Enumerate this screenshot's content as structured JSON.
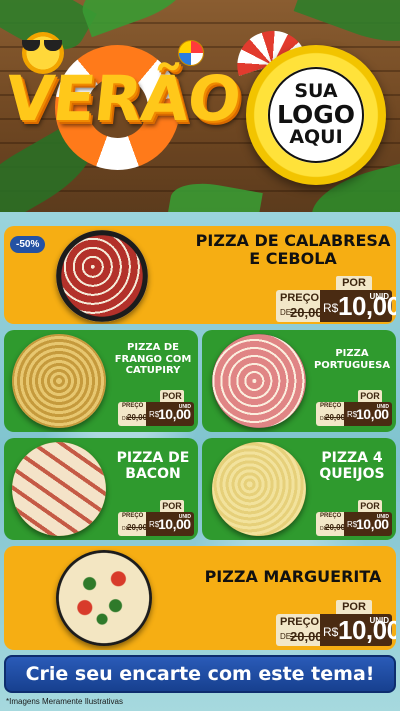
{
  "header": {
    "title": "VERÃO",
    "logo_lines": [
      "SUA",
      "LOGO",
      "AQUI"
    ]
  },
  "featured": [
    {
      "name_line1": "PIZZA DE CALABRESA",
      "name_line2": "E CEBOLA",
      "badge": "-50%",
      "por": "POR",
      "preco": "PREÇO",
      "de": "DE",
      "old_price": "20,00",
      "currency": "R$",
      "price": "10,00",
      "unit": "UNID"
    },
    {
      "name_line1": "PIZZA MARGUERITA",
      "por": "POR",
      "preco": "PREÇO",
      "de": "DE",
      "old_price": "20,00",
      "currency": "R$",
      "price": "10,00",
      "unit": "UNID"
    }
  ],
  "grid": [
    {
      "name_lines": [
        "PIZZA DE",
        "FRANGO COM",
        "CATUPIRY"
      ],
      "preco": "PREÇO",
      "por": "POR",
      "de": "DE",
      "old_price": "20,00",
      "currency": "R$",
      "price": "10,00",
      "unit": "UNID"
    },
    {
      "name_lines": [
        "PIZZA",
        "PORTUGUESA"
      ],
      "preco": "PREÇO",
      "por": "POR",
      "de": "DE",
      "old_price": "20,00",
      "currency": "R$",
      "price": "10,00",
      "unit": "UNID"
    },
    {
      "name_lines": [
        "PIZZA DE",
        "BACON"
      ],
      "preco": "PREÇO",
      "por": "POR",
      "de": "DE",
      "old_price": "20,00",
      "currency": "R$",
      "price": "10,00",
      "unit": "UNID"
    },
    {
      "name_lines": [
        "PIZZA 4",
        "QUEIJOS"
      ],
      "preco": "PREÇO",
      "por": "POR",
      "de": "DE",
      "old_price": "20,00",
      "currency": "R$",
      "price": "10,00",
      "unit": "UNID"
    }
  ],
  "cta": "Crie seu encarte com este tema!",
  "disclaimer": "*Imagens Meramente Ilustrativas",
  "colors": {
    "card_yellow": "#f6ae13",
    "card_green": "#2f9a2e",
    "price_dark": "#4a2b12",
    "cta_blue": "#2452a3"
  },
  "icons": [
    "sun-icon",
    "sunglasses-icon",
    "beach-ball-icon",
    "umbrella-icon",
    "life-ring-icon"
  ]
}
